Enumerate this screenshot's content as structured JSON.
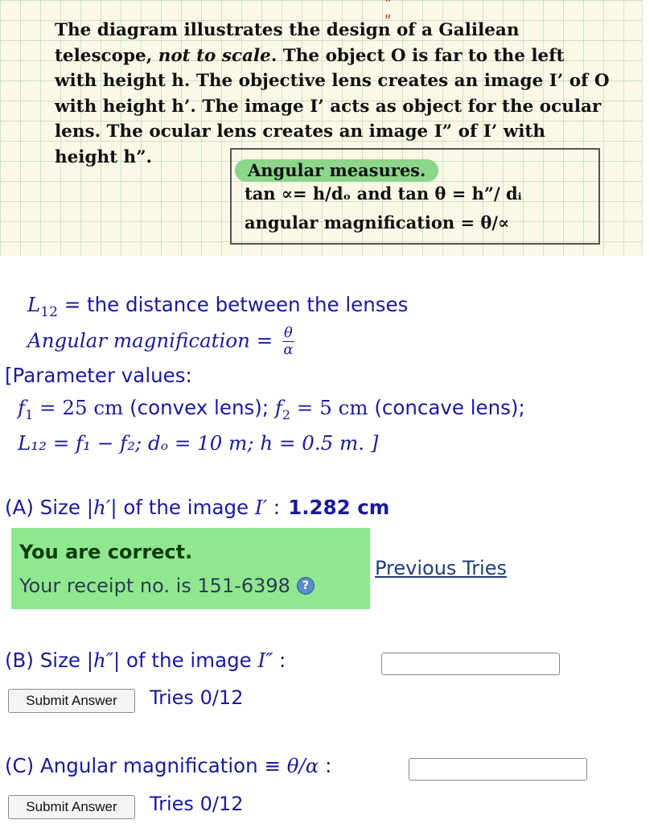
{
  "diagram": {
    "description_parts": [
      "The diagram illustrates the design of a Galilean telescope, ",
      "not to scale",
      ". The object O is far to the left with height h. The objective lens creates an image I’ of O with height h’.  The image I’ acts as object for the ocular lens. The ocular lens creates an image I” of I’ with height h”."
    ],
    "box_title": "Angular measures.",
    "box_line1": "tan ∝= h/dₒ  and   tan θ = h”/ dᵢ",
    "box_line2": "angular magnification = θ/∝"
  },
  "intro": {
    "l12_symbol": "L",
    "l12_sub": "12",
    "l12_text": " = the distance between the lenses",
    "ang_label": "Angular magnification",
    "ang_eq": " = ",
    "frac_top": "θ",
    "frac_bot": "α"
  },
  "params": {
    "title": "[Parameter values:",
    "f1_sym": "f",
    "f1_sub": "1",
    "f1_val": " = 25 cm",
    "f1_note": "  (convex lens);  ",
    "f2_sym": "f",
    "f2_sub": "2",
    "f2_val": " = 5 cm",
    "f2_note": "  (concave lens);",
    "line2": "L₁₂ = f₁ − f₂;  dₒ = 10 m;  h = 0.5 m. ]"
  },
  "partA": {
    "label_pre": "(A) Size |",
    "label_var": "h′",
    "label_mid": "| of the image ",
    "label_img": "I′",
    "label_post": " :",
    "answer": "1.282 cm",
    "feedback_title": "You are correct.",
    "receipt": "Your receipt no. is 151-6398",
    "help_icon": "?",
    "prev_tries": "Previous Tries"
  },
  "partB": {
    "label_pre": "(B) Size |",
    "label_var": "h″",
    "label_mid": "| of the image ",
    "label_img": "I″",
    "label_post": " :",
    "input_value": "",
    "submit": "Submit Answer",
    "tries": "Tries 0/12"
  },
  "partC": {
    "label_pre": "(C) Angular magnification ≡ ",
    "label_math": "θ/α",
    "label_post": " :",
    "input_value": "",
    "submit": "Submit Answer",
    "tries": "Tries 0/12"
  }
}
